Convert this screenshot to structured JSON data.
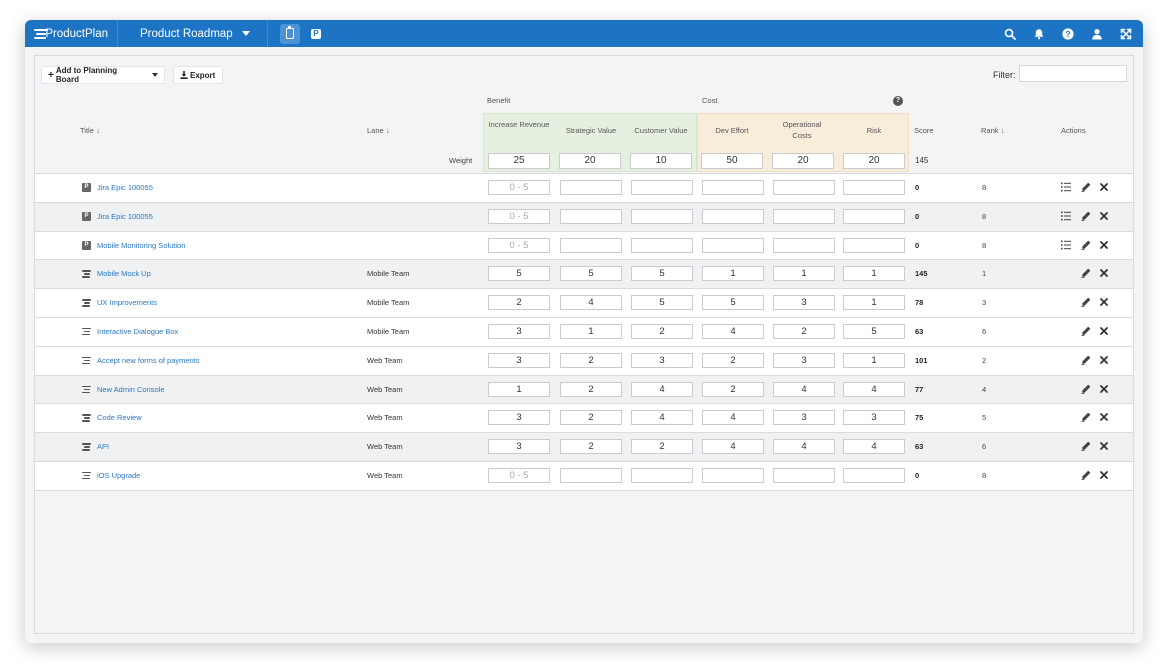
{
  "app": {
    "brand": "ProductPlan",
    "roadmap_title": "Product Roadmap",
    "accent": "#1d74c4"
  },
  "topbar_icons": [
    "search-icon",
    "bell-icon",
    "help-icon",
    "user-icon",
    "expand-icon"
  ],
  "toolbar": {
    "add_label": "Add to Planning Board",
    "export_label": "Export",
    "filter_label": "Filter:",
    "filter_value": ""
  },
  "groups": {
    "benefit": "Benefit",
    "cost": "Cost",
    "benefit_color": "#e6f0e0",
    "cost_color": "#f8ecdb"
  },
  "columns": {
    "title": "Title",
    "lane": "Lane",
    "increase_revenue": "Increase Revenue",
    "strategic_value": "Strategic Value",
    "customer_value": "Customer Value",
    "dev_effort": "Dev Effort",
    "operational_costs": "Operational Costs",
    "risk": "Risk",
    "score": "Score",
    "rank": "Rank",
    "actions": "Actions"
  },
  "weights": {
    "label": "Weight",
    "values": [
      "25",
      "20",
      "10",
      "50",
      "20",
      "20"
    ],
    "score": "145"
  },
  "placeholder": "0 - 5",
  "rows": [
    {
      "icon": "jira",
      "title": "Jira Epic 100055",
      "lane": "",
      "values": [
        "",
        "",
        "",
        "",
        "",
        ""
      ],
      "score": "0",
      "rank": "8",
      "scored": false
    },
    {
      "icon": "jira",
      "title": "Jira Epic 100055",
      "lane": "",
      "values": [
        "",
        "",
        "",
        "",
        "",
        ""
      ],
      "score": "0",
      "rank": "8",
      "scored": false
    },
    {
      "icon": "jira",
      "title": "Mobile Monitoring Solution",
      "lane": "",
      "values": [
        "",
        "",
        "",
        "",
        "",
        ""
      ],
      "score": "0",
      "rank": "8",
      "scored": false
    },
    {
      "icon": "bar",
      "title": "Mobile Mock Up",
      "lane": "Mobile Team",
      "values": [
        "5",
        "5",
        "5",
        "1",
        "1",
        "1"
      ],
      "score": "145",
      "rank": "1",
      "scored": true
    },
    {
      "icon": "bar",
      "title": "UX Improvements",
      "lane": "Mobile Team",
      "values": [
        "2",
        "4",
        "5",
        "5",
        "3",
        "1"
      ],
      "score": "78",
      "rank": "3",
      "scored": true
    },
    {
      "icon": "bar",
      "title": "Interactive Dialogue Box",
      "lane": "Mobile Team",
      "values": [
        "3",
        "1",
        "2",
        "4",
        "2",
        "5"
      ],
      "score": "63",
      "rank": "6",
      "scored": true
    },
    {
      "icon": "bar",
      "title": "Accept new forms of payments",
      "lane": "Web Team",
      "values": [
        "3",
        "2",
        "3",
        "2",
        "3",
        "1"
      ],
      "score": "101",
      "rank": "2",
      "scored": true
    },
    {
      "icon": "bar",
      "title": "New Admin Console",
      "lane": "Web Team",
      "values": [
        "1",
        "2",
        "4",
        "2",
        "4",
        "4"
      ],
      "score": "77",
      "rank": "4",
      "scored": true
    },
    {
      "icon": "bar",
      "title": "Code Review",
      "lane": "Web Team",
      "values": [
        "3",
        "2",
        "4",
        "4",
        "3",
        "3"
      ],
      "score": "75",
      "rank": "5",
      "scored": true
    },
    {
      "icon": "bar",
      "title": "API",
      "lane": "Web Team",
      "values": [
        "3",
        "2",
        "2",
        "4",
        "4",
        "4"
      ],
      "score": "63",
      "rank": "6",
      "scored": true
    },
    {
      "icon": "bar",
      "title": "iOS Upgrade",
      "lane": "Web Team",
      "values": [
        "",
        "",
        "",
        "",
        "",
        ""
      ],
      "score": "0",
      "rank": "8",
      "scored": false
    }
  ]
}
